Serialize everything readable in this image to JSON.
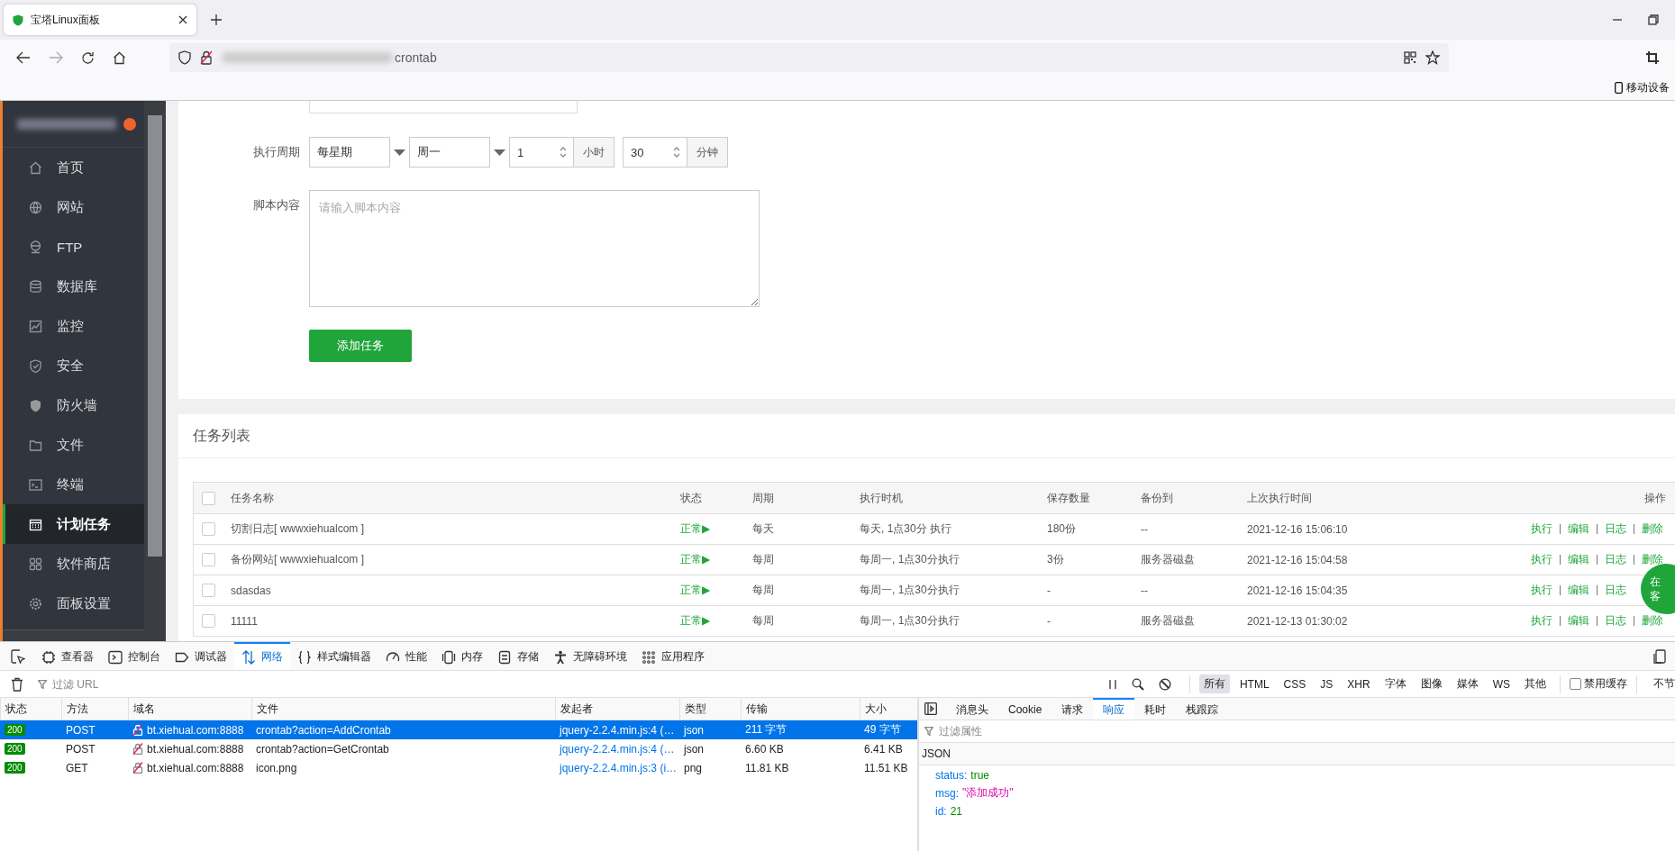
{
  "browser": {
    "tab": {
      "title": "宝塔Linux面板"
    },
    "address": {
      "text": "crontab"
    },
    "toolbar_right": {
      "label": "移动设备"
    }
  },
  "sidebar": {
    "items": [
      {
        "label": "首页",
        "selected": false
      },
      {
        "label": "网站",
        "selected": false
      },
      {
        "label": "FTP",
        "selected": false
      },
      {
        "label": "数据库",
        "selected": false
      },
      {
        "label": "监控",
        "selected": false
      },
      {
        "label": "安全",
        "selected": false
      },
      {
        "label": "防火墙",
        "selected": false
      },
      {
        "label": "文件",
        "selected": false
      },
      {
        "label": "终端",
        "selected": false
      },
      {
        "label": "计划任务",
        "selected": true
      },
      {
        "label": "软件商店",
        "selected": false
      },
      {
        "label": "面板设置",
        "selected": false
      }
    ]
  },
  "form": {
    "cycle": {
      "label": "执行周期",
      "type": "每星期",
      "weekday": "周一",
      "hour": "1",
      "hour_unit": "小时",
      "minute": "30",
      "minute_unit": "分钟"
    },
    "script": {
      "label": "脚本内容",
      "placeholder": "请输入脚本内容"
    },
    "submit": "添加任务"
  },
  "task_list": {
    "title": "任务列表",
    "all_checked": false,
    "columns": [
      "任务名称",
      "状态",
      "周期",
      "执行时机",
      "保存数量",
      "备份到",
      "上次执行时间",
      "操作"
    ],
    "rows": [
      {
        "checked": false,
        "name": "切割日志[ wwwxiehualcom ]",
        "status": "正常▶",
        "cycle": "每天",
        "timing": "每天, 1点30分 执行",
        "keep": "180份",
        "backup": "--",
        "last_run": "2021-12-16 15:06:10",
        "actions": [
          "执行",
          "编辑",
          "日志",
          "删除"
        ]
      },
      {
        "checked": false,
        "name": "备份网站[ wwwxiehualcom ]",
        "status": "正常▶",
        "cycle": "每周",
        "timing": "每周一, 1点30分执行",
        "keep": "3份",
        "backup": "服务器磁盘",
        "last_run": "2021-12-16 15:04:58",
        "actions": [
          "执行",
          "编辑",
          "日志",
          "删除"
        ]
      },
      {
        "checked": false,
        "name": "sdasdas",
        "status": "正常▶",
        "cycle": "每周",
        "timing": "每周一, 1点30分执行",
        "keep": "-",
        "backup": "--",
        "last_run": "2021-12-16 15:04:35",
        "actions": [
          "执行",
          "编辑",
          "日志"
        ]
      },
      {
        "checked": false,
        "name": "11111",
        "status": "正常▶",
        "cycle": "每周",
        "timing": "每周一, 1点30分执行",
        "keep": "-",
        "backup": "服务器磁盘",
        "last_run": "2021-12-13 01:30:02",
        "actions": [
          "执行",
          "编辑",
          "日志",
          "删除"
        ]
      }
    ]
  },
  "chat_bubble": {
    "lines": [
      "在",
      "客"
    ]
  },
  "devtools": {
    "tools": [
      {
        "label": "查看器",
        "selected": false
      },
      {
        "label": "控制台",
        "selected": false
      },
      {
        "label": "调试器",
        "selected": false
      },
      {
        "label": "网络",
        "selected": true
      },
      {
        "label": "样式编辑器",
        "selected": false
      },
      {
        "label": "性能",
        "selected": false
      },
      {
        "label": "内存",
        "selected": false
      },
      {
        "label": "存储",
        "selected": false
      },
      {
        "label": "无障碍环境",
        "selected": false
      },
      {
        "label": "应用程序",
        "selected": false
      }
    ],
    "filter": {
      "placeholder": "过滤 URL"
    },
    "type_filters": [
      {
        "label": "所有",
        "selected": true
      },
      {
        "label": "HTML",
        "selected": false
      },
      {
        "label": "CSS",
        "selected": false
      },
      {
        "label": "JS",
        "selected": false
      },
      {
        "label": "XHR",
        "selected": false
      },
      {
        "label": "字体",
        "selected": false
      },
      {
        "label": "图像",
        "selected": false
      },
      {
        "label": "媒体",
        "selected": false
      },
      {
        "label": "WS",
        "selected": false
      },
      {
        "label": "其他",
        "selected": false
      }
    ],
    "disable_cache": {
      "label": "禁用缓存",
      "checked": false
    },
    "throttle": "不节",
    "requests": {
      "columns": [
        "状态",
        "方法",
        "域名",
        "文件",
        "发起者",
        "类型",
        "传输",
        "大小"
      ],
      "rows": [
        {
          "selected": true,
          "status": "200",
          "method": "POST",
          "domain": "bt.xiehual.com:8888",
          "file": "crontab?action=AddCrontab",
          "initiator": "jquery-2.2.4.min.js:4 (…",
          "type": "json",
          "transferred": "211 字节",
          "size": "49 字节"
        },
        {
          "selected": false,
          "status": "200",
          "method": "POST",
          "domain": "bt.xiehual.com:8888",
          "file": "crontab?action=GetCrontab",
          "initiator": "jquery-2.2.4.min.js:4 (…",
          "type": "json",
          "transferred": "6.60 KB",
          "size": "6.41 KB"
        },
        {
          "selected": false,
          "status": "200",
          "method": "GET",
          "domain": "bt.xiehual.com:8888",
          "file": "icon.png",
          "initiator": "jquery-2.2.4.min.js:3 (i…",
          "type": "png",
          "transferred": "11.81 KB",
          "size": "11.51 KB"
        }
      ]
    },
    "details": {
      "tabs": [
        {
          "label": "消息头",
          "selected": false
        },
        {
          "label": "Cookie",
          "selected": false
        },
        {
          "label": "请求",
          "selected": false
        },
        {
          "label": "响应",
          "selected": true
        },
        {
          "label": "耗时",
          "selected": false
        },
        {
          "label": "栈跟踪",
          "selected": false
        }
      ],
      "filter": {
        "placeholder": "过滤属性"
      },
      "section": "JSON",
      "fields": [
        {
          "key": "status:",
          "value": "true",
          "kind": "boolean"
        },
        {
          "key": "msg:",
          "value": "\"添加成功\"",
          "kind": "string"
        },
        {
          "key": "id:",
          "value": "21",
          "kind": "number"
        }
      ]
    }
  }
}
